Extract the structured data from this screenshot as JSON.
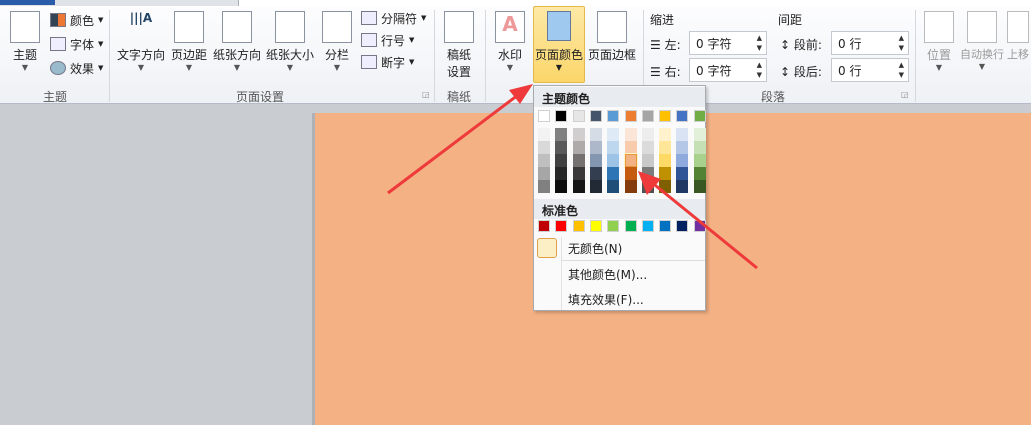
{
  "ribbon": {
    "theme_group": {
      "label": "主题",
      "themes": "主题",
      "colors": "颜色",
      "fonts": "字体",
      "effects": "效果"
    },
    "page_setup_group": {
      "label": "页面设置",
      "text_direction": "文字方向",
      "margins": "页边距",
      "orientation": "纸张方向",
      "size": "纸张大小",
      "columns": "分栏",
      "breaks": "分隔符",
      "line_numbers": "行号",
      "hyphenation": "断字"
    },
    "manuscript_group": {
      "label": "稿纸",
      "manuscript_setup_1": "稿纸",
      "manuscript_setup_2": "设置"
    },
    "page_bg_group": {
      "watermark": "水印",
      "page_color": "页面颜色",
      "page_borders": "页面边框"
    },
    "paragraph_group": {
      "label": "段落",
      "indent": "缩进",
      "spacing": "间距",
      "left": "左:",
      "right": "右:",
      "before": "段前:",
      "after": "段后:",
      "left_val": "0 字符",
      "right_val": "0 字符",
      "before_val": "0 行",
      "after_val": "0 行"
    },
    "arrange_group": {
      "position": "位置",
      "wrap_text": "自动换行",
      "bring_forward": "上移"
    }
  },
  "color_menu": {
    "theme_colors_label": "主题颜色",
    "theme_colors": [
      "#ffffff",
      "#000000",
      "#e7e6e6",
      "#44546a",
      "#5b9bd5",
      "#ed7d31",
      "#a5a5a5",
      "#ffc000",
      "#4472c4",
      "#70ad47"
    ],
    "shades": [
      [
        "#f2f2f2",
        "#d9d9d9",
        "#bfbfbf",
        "#a6a6a6",
        "#808080"
      ],
      [
        "#808080",
        "#595959",
        "#404040",
        "#262626",
        "#0d0d0d"
      ],
      [
        "#d0cece",
        "#aeaaaa",
        "#757171",
        "#3a3838",
        "#171616"
      ],
      [
        "#d6dce5",
        "#adb9ca",
        "#8497b0",
        "#333f50",
        "#222a35"
      ],
      [
        "#deebf7",
        "#bdd7ee",
        "#9dc3e6",
        "#2e75b6",
        "#1f4e79"
      ],
      [
        "#fbe5d6",
        "#f8cbad",
        "#f4b183",
        "#c55a11",
        "#843c0c"
      ],
      [
        "#ededed",
        "#dbdbdb",
        "#c9c9c9",
        "#7b7b7b",
        "#525252"
      ],
      [
        "#fff2cc",
        "#ffe699",
        "#ffd966",
        "#bf9000",
        "#7f6000"
      ],
      [
        "#dae3f3",
        "#b4c7e7",
        "#8faadc",
        "#2f5597",
        "#203864"
      ],
      [
        "#e2f0d9",
        "#c5e0b4",
        "#a9d18e",
        "#548235",
        "#385723"
      ]
    ],
    "selected": "#f4b183",
    "standard_colors_label": "标准色",
    "standard_colors": [
      "#c00000",
      "#ff0000",
      "#ffc000",
      "#ffff00",
      "#92d050",
      "#00b050",
      "#00b0f0",
      "#0070c0",
      "#002060",
      "#7030a0"
    ],
    "no_color": "无颜色(N)",
    "more_colors": "其他颜色(M)...",
    "fill_effects": "填充效果(F)..."
  },
  "page_color": "#f4b183"
}
